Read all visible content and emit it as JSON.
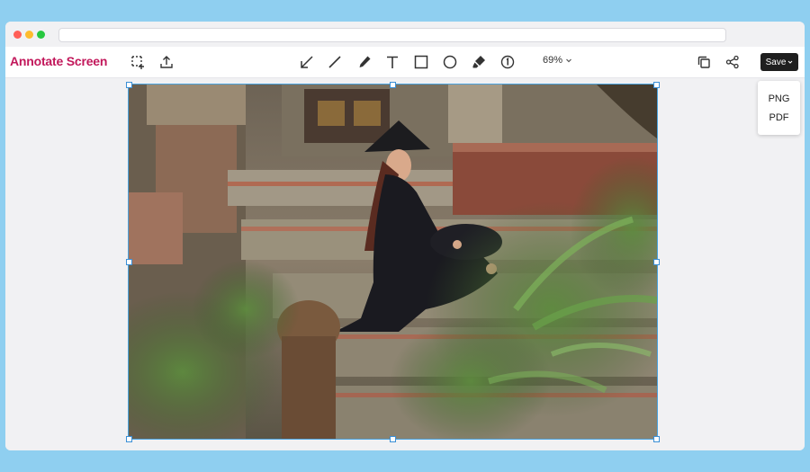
{
  "app": {
    "title": "Annotate Screen"
  },
  "toolbar": {
    "left_tools": [
      {
        "name": "crop-icon"
      },
      {
        "name": "upload-icon"
      }
    ],
    "tools": [
      {
        "name": "arrow-icon"
      },
      {
        "name": "line-icon"
      },
      {
        "name": "pen-icon"
      },
      {
        "name": "text-icon"
      },
      {
        "name": "rectangle-icon"
      },
      {
        "name": "circle-icon"
      },
      {
        "name": "highlighter-icon"
      },
      {
        "name": "step-number-icon"
      }
    ],
    "zoom_label": "69%",
    "right_tools": [
      {
        "name": "copy-icon"
      },
      {
        "name": "share-icon"
      }
    ],
    "save_label": "Save"
  },
  "save_menu": {
    "options": [
      "PNG",
      "PDF"
    ]
  },
  "colors": {
    "brand": "#c2185b",
    "selection": "#3b8fd6",
    "save_bg": "#1f1f1f"
  }
}
